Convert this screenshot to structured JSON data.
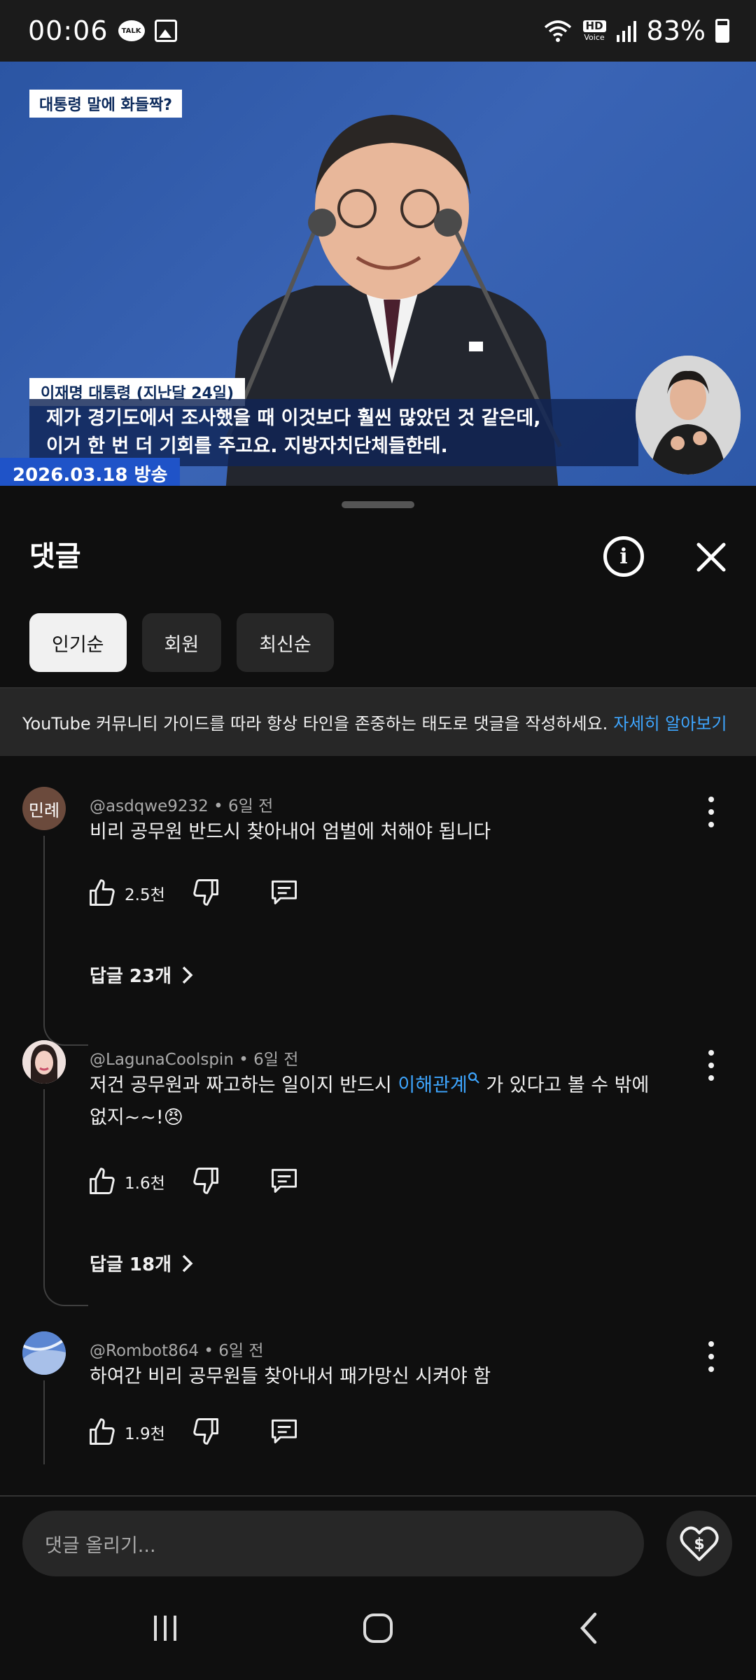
{
  "status_bar": {
    "time": "00:06",
    "talk_badge": "TALK",
    "hd_badge": "HD",
    "hd_sub": "Voice",
    "battery": "83%"
  },
  "video": {
    "tag": "대통령 말에 화들짝?",
    "nameplate": "이재명 대통령 (지난달 24일)",
    "caption_line1": "제가 경기도에서 조사했을 때 이것보다 훨씬 많았던 것 같은데,",
    "caption_line2": "이거 한 번 더 기회를 주고요. 지방자치단체들한테.",
    "airdate": "2026.03.18 방송"
  },
  "sheet": {
    "title": "댓글",
    "chips": [
      {
        "label": "인기순",
        "active": true
      },
      {
        "label": "회원",
        "active": false
      },
      {
        "label": "최신순",
        "active": false
      }
    ],
    "guide_text": "YouTube 커뮤니티 가이드를 따라 항상 타인을 존중하는 태도로 댓글을 작성하세요.",
    "guide_link": "자세히 알아보기"
  },
  "comments": [
    {
      "avatar_text": "민례",
      "avatar_color": "#6b4a3c",
      "author": "@asdqwe9232",
      "time": "6일 전",
      "text": "비리 공무원 반드시 찾아내어 엄벌에 처해야 됩니다",
      "likes": "2.5천",
      "replies": "답글 23개"
    },
    {
      "avatar_text": "",
      "avatar_color": "#e9d7d5",
      "author": "@LagunaCoolspin",
      "time": "6일 전",
      "text_before": "저건 공무원과 짜고하는 일이지  반드시 ",
      "mention": "이해관계",
      "text_after": " 가 있다고 볼 수 밖에",
      "text_line2": "없지~~!😠",
      "likes": "1.6천",
      "replies": "답글 18개"
    },
    {
      "avatar_text": "",
      "avatar_color": "#4a78c6",
      "author": "@Rombot864",
      "time": "6일 전",
      "text": "하여간 비리 공무원들 찾아내서 패가망신 시켜야 함",
      "likes": "1.9천"
    }
  ],
  "compose": {
    "placeholder": "댓글 올리기..."
  },
  "colors": {
    "background": "#0f0f0f",
    "chip": "#272727",
    "link": "#3ea6ff",
    "video_blue": "#2b55a3"
  },
  "icons": [
    "info-icon",
    "close-icon",
    "thumbs-up-icon",
    "thumbs-down-icon",
    "reply-icon",
    "more-vert-icon",
    "chevron-right-icon",
    "thanks-heart-icon",
    "recents-icon",
    "home-icon",
    "back-icon"
  ]
}
